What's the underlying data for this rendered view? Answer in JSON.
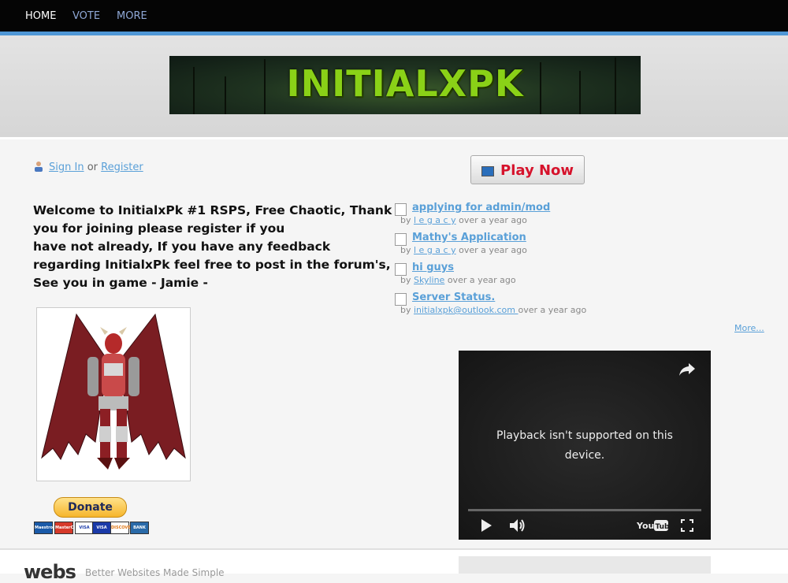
{
  "nav": {
    "items": [
      {
        "label": "HOME",
        "active": true
      },
      {
        "label": "VOTE",
        "active": false
      },
      {
        "label": "MORE",
        "active": false
      }
    ]
  },
  "banner": {
    "title": "INITIALXPK"
  },
  "auth": {
    "signin": "Sign In",
    "or": "or",
    "register": "Register"
  },
  "welcome": {
    "lines": [
      "Welcome to InitialxPk #1 RSPS, Free Chaotic, Thank",
      "you for joining please register if you",
      "have not already, If you have any feedback",
      "regarding InitialxPk feel free to post in the  forum's,",
      "See you in game -  Jamie -"
    ]
  },
  "play_now": {
    "label": "Play Now"
  },
  "forum": {
    "posts": [
      {
        "title": "applying for admin/mod",
        "by": "by",
        "author": "l e g a c y",
        "time": "over a year ago"
      },
      {
        "title": "Mathy's Application",
        "by": "by",
        "author": "l e g a c y",
        "time": "over a year ago"
      },
      {
        "title": "hi guys",
        "by": "by",
        "author": "Skyline",
        "time": "over a year ago"
      },
      {
        "title": "Server Status.",
        "by": "by",
        "author": "initialxpk@outlook.com ",
        "time": "over a year ago"
      }
    ],
    "more_label": "More..."
  },
  "video": {
    "message": "Playback isn't supported on this device.",
    "youtube_label": "YouTube"
  },
  "donate": {
    "label": "Donate",
    "cards": [
      "Maestro",
      "MasterCard",
      "VISA",
      "VISA",
      "DISCOVER",
      "BANK"
    ]
  },
  "footer": {
    "logo": "webs",
    "text": "Better Websites Made Simple"
  },
  "colors": {
    "nav_bg": "#050505",
    "accent_line": "#4f97d6",
    "link": "#5aa0d8",
    "play_red": "#d6132c",
    "banner_green": "#8ad117"
  }
}
